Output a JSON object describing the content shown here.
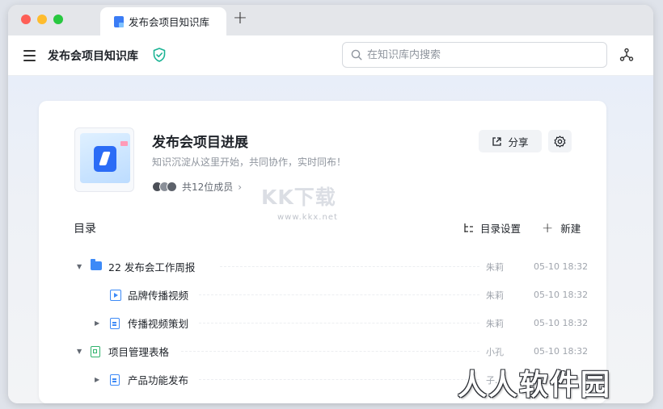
{
  "tab": {
    "title": "发布会项目知识库"
  },
  "toolbar": {
    "title": "发布会项目知识库",
    "search_placeholder": "在知识库内搜索"
  },
  "space": {
    "name": "发布会项目进展",
    "description": "知识沉淀从这里开始，共同协作，实时同布！",
    "members": "共12位成员",
    "share_label": "分享"
  },
  "toc": {
    "title": "目录",
    "settings_label": "目录设置",
    "new_label": "新建",
    "rows": [
      {
        "label": "22 发布会工作周报",
        "owner": "朱莉",
        "time": "05-10 18:32",
        "icon": "folder-icon",
        "arrow": "▼"
      },
      {
        "label": "品牌传播视频",
        "owner": "朱莉",
        "time": "05-10 18:32",
        "icon": "video-icon",
        "arrow": ""
      },
      {
        "label": "传播视频策划",
        "owner": "朱莉",
        "time": "05-10 18:32",
        "icon": "doc-icon",
        "arrow": "▶"
      },
      {
        "label": "项目管理表格",
        "owner": "小孔",
        "time": "05-10 18:32",
        "icon": "sheet-icon",
        "arrow": "▼"
      },
      {
        "label": "产品功能发布",
        "owner": "子..",
        "time": "",
        "icon": "doc-icon",
        "arrow": "▶"
      }
    ]
  },
  "watermarks": {
    "top": "KK下载",
    "top_url": "www.kkx.net",
    "bottom": "人人软件园"
  },
  "colors": {
    "accent": "#3d8af7",
    "sheet": "#2fb36b",
    "shield": "#1ab394"
  }
}
